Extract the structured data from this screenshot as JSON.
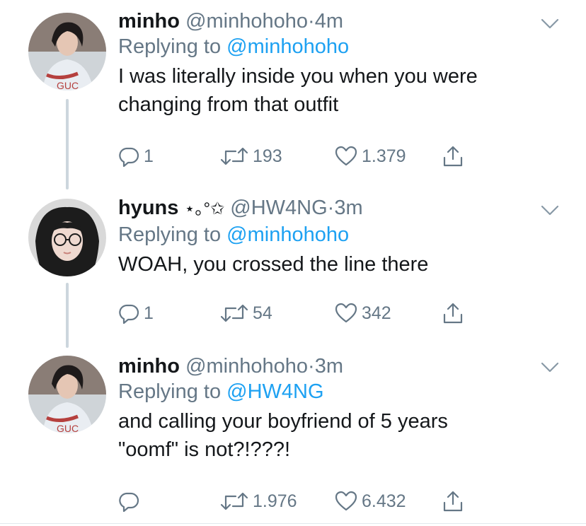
{
  "tweets": [
    {
      "name": "minho",
      "handle": "@minhohoho",
      "dot": "·",
      "time": "4m",
      "replying_prefix": "Replying to",
      "replying_to": "@minhohoho",
      "text_lines": [
        "I was literally inside you when you were",
        "changing from that outfit"
      ],
      "replies": "1",
      "retweets": "193",
      "likes": "1.379"
    },
    {
      "name": "hyuns",
      "name_deco": "⋆｡°✩",
      "handle": "@HW4NG",
      "dot": "·",
      "time": "3m",
      "replying_prefix": "Replying to",
      "replying_to": "@minhohoho",
      "text_lines": [
        "WOAH, you crossed the line there"
      ],
      "replies": "1",
      "retweets": "54",
      "likes": "342"
    },
    {
      "name": "minho",
      "handle": "@minhohoho",
      "dot": "·",
      "time": "3m",
      "replying_prefix": "Replying to",
      "replying_to": "@HW4NG",
      "text_lines": [
        "and calling your boyfriend of 5 years",
        "\"oomf\" is not?!???!"
      ],
      "replies": "",
      "retweets": "1.976",
      "likes": "6.432"
    }
  ],
  "colors": {
    "text": "#14171a",
    "secondary": "#657786",
    "link": "#1da1f2",
    "thread_line": "#ccd6dd"
  },
  "icons": [
    "reply-icon",
    "retweet-icon",
    "like-icon",
    "share-icon",
    "chevron-down-icon"
  ]
}
